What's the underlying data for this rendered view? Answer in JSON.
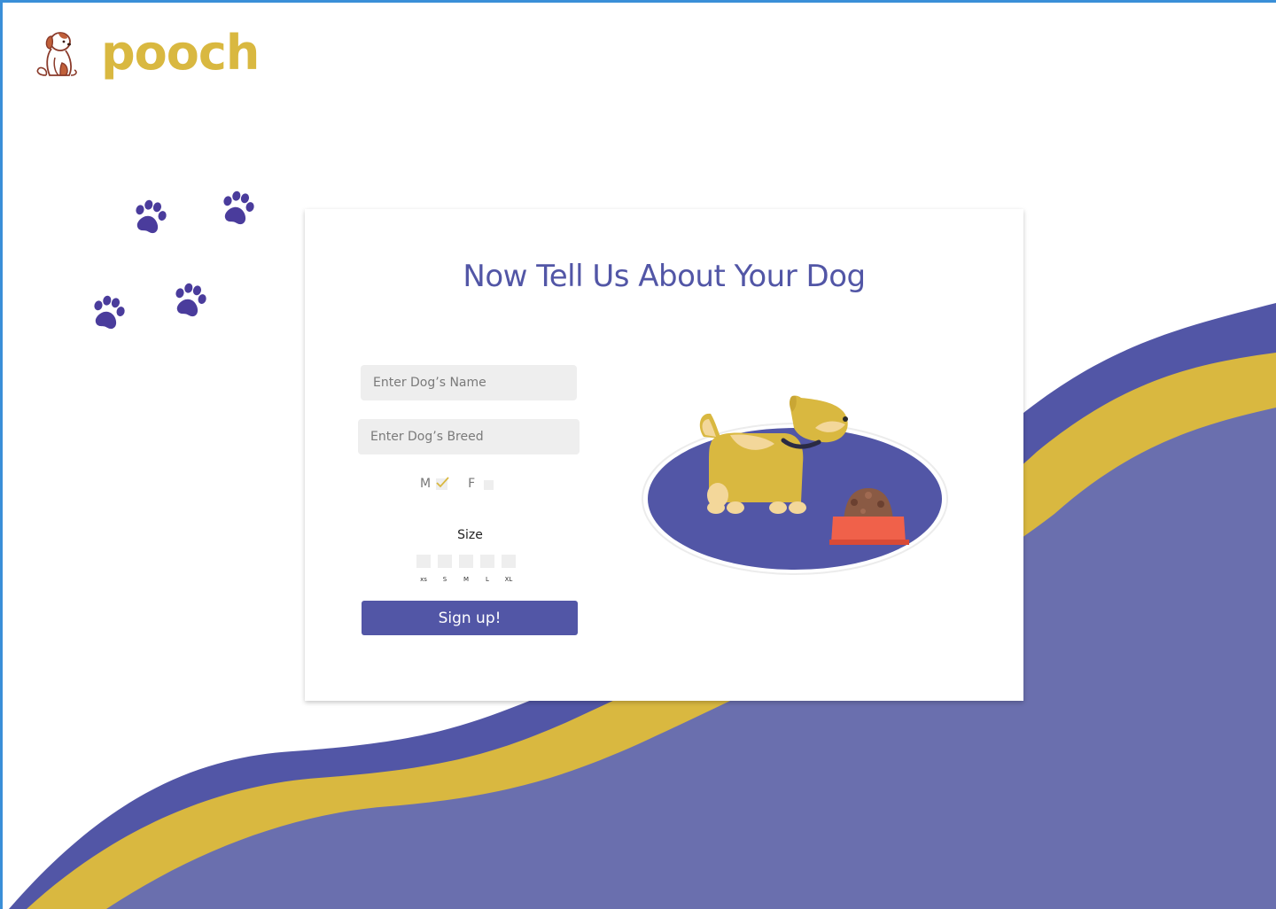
{
  "brand": {
    "name": "pooch",
    "logo_icon": "sitting-puppy-icon"
  },
  "colors": {
    "brand_yellow": "#d9b840",
    "primary_purple": "#5256a6",
    "wave_light": "#6a6fae",
    "input_bg": "#eeeeee",
    "title": "#5256a6"
  },
  "decor": {
    "paw_icon": "paw-print-icon"
  },
  "form": {
    "title": "Now Tell Us About Your Dog",
    "name_placeholder": "Enter Dog’s Name",
    "breed_placeholder": "Enter Dog’s Breed",
    "gender": {
      "options": [
        {
          "label": "M",
          "checked": true
        },
        {
          "label": "F",
          "checked": false
        }
      ]
    },
    "size": {
      "label": "Size",
      "options": [
        "xs",
        "S",
        "M",
        "L",
        "XL"
      ]
    },
    "submit_label": "Sign up!"
  },
  "illustration": {
    "icon": "dog-with-food-bowl-icon"
  }
}
